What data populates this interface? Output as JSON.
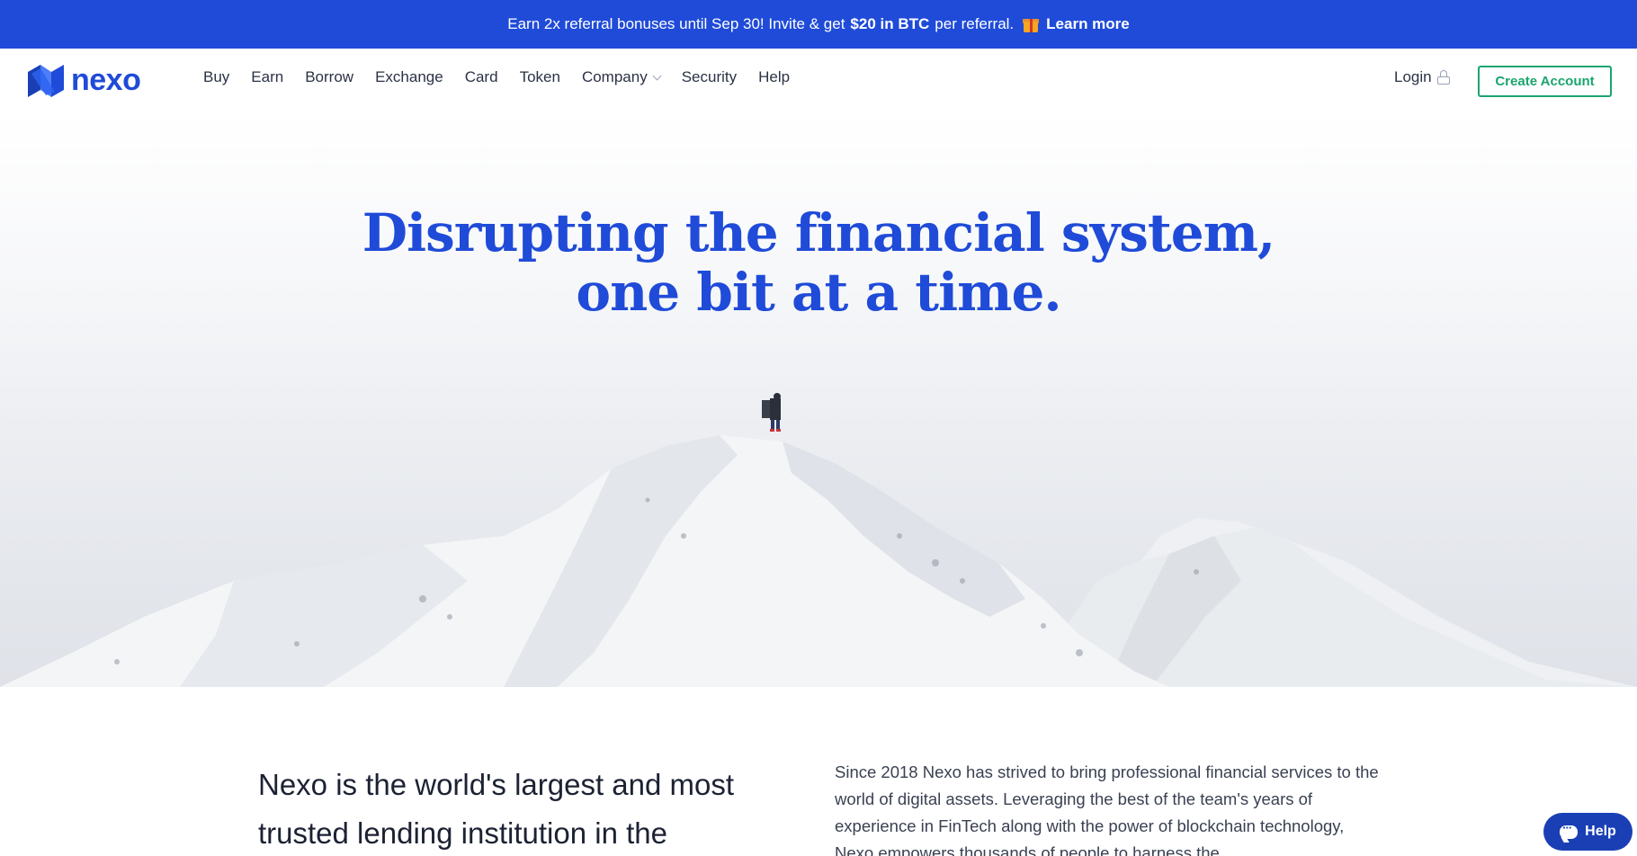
{
  "promo": {
    "text_before": "Earn 2x referral bonuses until Sep 30! Invite & get",
    "highlight": "$20 in BTC",
    "text_after": "per referral.",
    "link": "Learn more",
    "gift_icon": "gift-icon"
  },
  "header": {
    "logo_text": "nexo",
    "nav": [
      "Buy",
      "Earn",
      "Borrow",
      "Exchange",
      "Card",
      "Token",
      "Company",
      "Security",
      "Help"
    ],
    "login": "Login",
    "create_account": "Create Account"
  },
  "hero": {
    "title_line1": "Disrupting the financial system,",
    "title_line2": "one bit at a time."
  },
  "about": {
    "lead": "Nexo is the world's largest and most trusted lending institution in the",
    "description": "Since 2018 Nexo has strived to bring professional financial services to the world of digital assets. Leveraging the best of the team's years of experience in FinTech along with the power of blockchain technology, Nexo empowers thousands of people to harness the"
  },
  "help_widget": {
    "label": "Help"
  },
  "colors": {
    "brand_blue": "#1f4bd8",
    "accent_green": "#1aa56e",
    "chat_blue": "#1a3fb5"
  }
}
